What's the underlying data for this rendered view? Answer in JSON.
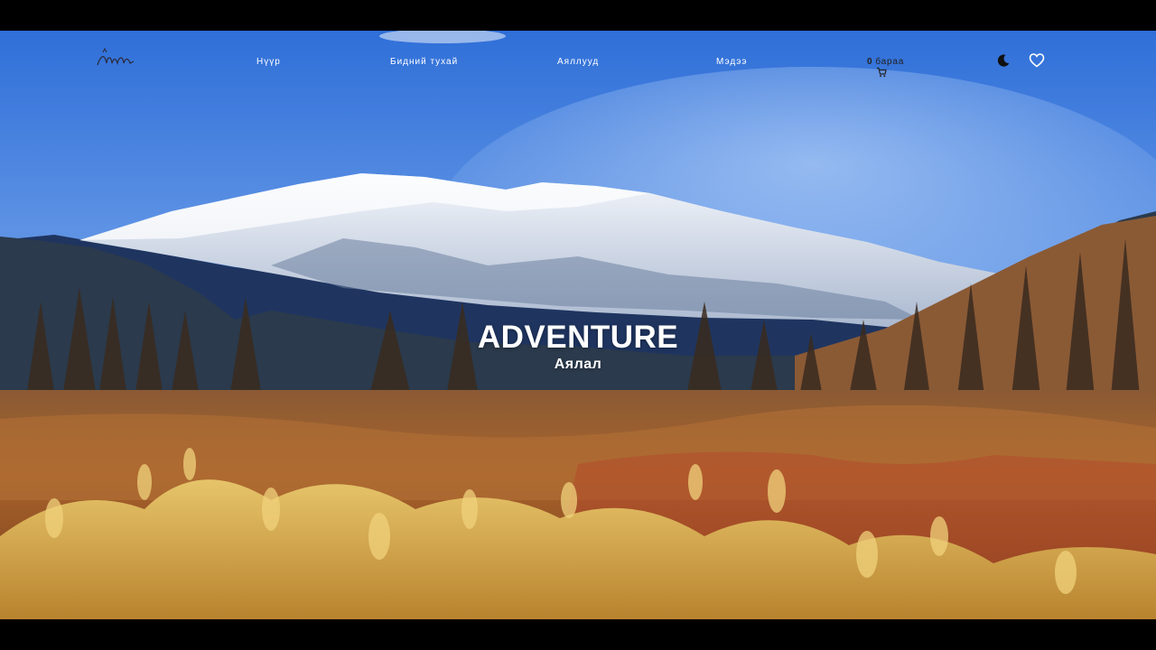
{
  "nav": {
    "items": [
      {
        "label": "Нүүр"
      },
      {
        "label": "Бидний тухай"
      },
      {
        "label": "Аяллууд"
      },
      {
        "label": "Мэдээ"
      }
    ],
    "cart": {
      "count": "0",
      "label": "бараа"
    }
  },
  "hero": {
    "title": "ADVENTURE",
    "subtitle": "Аялал"
  },
  "icons": {
    "logo": "adventure-script-logo",
    "cart": "cart-icon",
    "theme_toggle": "moon-icon",
    "favorites": "heart-icon"
  },
  "colors": {
    "sky_top": "#2f6fd8",
    "sky_bottom": "#9fc3f3",
    "grass": "#a9642c",
    "grass_highlight": "#e3c063",
    "nav_text": "#ffffff"
  }
}
